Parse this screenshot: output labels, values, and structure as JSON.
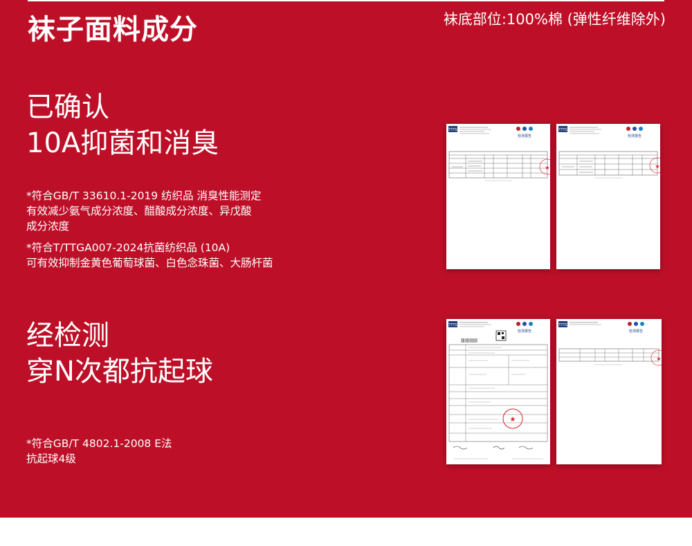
{
  "header": {
    "title": "袜子面料成分",
    "composition": "袜底部位:100%棉 (弹性纤维除外)"
  },
  "section1": {
    "heading_line1": "已确认",
    "heading_line2": "10A抑菌和消臭",
    "note1_line1": "*符合GB/T 33610.1-2019 纺织品 消臭性能测定",
    "note1_line2": "有效减少氨气成分浓度、醋酸成分浓度、异戊酸",
    "note1_line3": "成分浓度",
    "note2_line1": "*符合T/TTGA007-2024抗菌纺织品 (10A)",
    "note2_line2": "可有效抑制金黄色葡萄球菌、白色念珠菌、大肠杆菌"
  },
  "section2": {
    "heading_line1": "经检测",
    "heading_line2": "穿N次都抗起球",
    "note_line1": "*符合GB/T 4802.1-2008 E法",
    "note_line2": "抗起球4级"
  },
  "documents": {
    "lab_logo": "TTTS",
    "report_title": "检测报告"
  },
  "colors": {
    "background": "#bd1028",
    "text": "#ffffff",
    "stamp": "#d81e2a"
  }
}
